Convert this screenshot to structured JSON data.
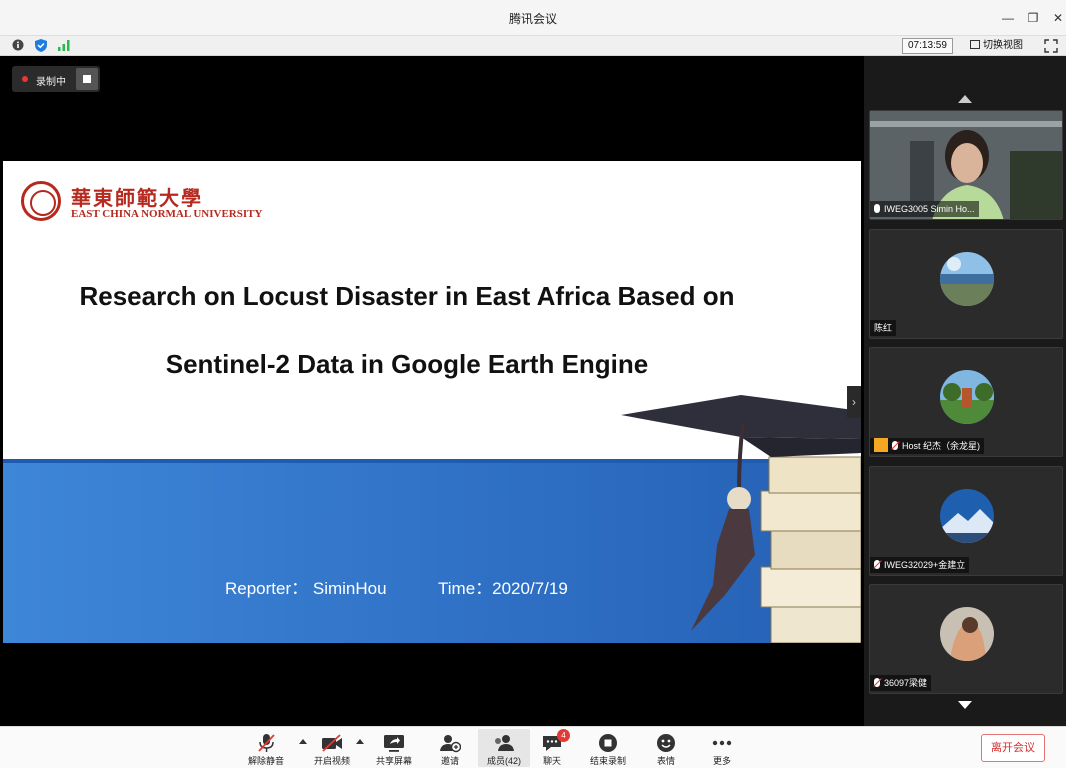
{
  "window": {
    "title": "腾讯会议"
  },
  "infobar": {
    "timer": "07:13:59",
    "switch_view": "切换视图"
  },
  "recording": {
    "label": "录制中"
  },
  "slide": {
    "logo_cn": "華東師範大學",
    "logo_en": "EAST CHINA NORMAL UNIVERSITY",
    "title_line1": "Research on Locust Disaster in East Africa Based on",
    "title_line2": "Sentinel-2 Data in Google Earth Engine",
    "reporter": "Reporter： SiminHou",
    "time": "Time：2020/7/19"
  },
  "participants": [
    {
      "name": "IWEG3005 Simin Ho...",
      "mic": "on"
    },
    {
      "name": "陈红",
      "mic": "none"
    },
    {
      "name": "Host 纪杰（余龙星)",
      "mic": "off",
      "host": true
    },
    {
      "name": "IWEG32029+金建立",
      "mic": "off"
    },
    {
      "name": "36097梁健",
      "mic": "off"
    }
  ],
  "toolbar": {
    "unmute": "解除静音",
    "start_video": "开启视频",
    "share_screen": "共享屏幕",
    "invite": "邀请",
    "members": "成员(42)",
    "chat": "聊天",
    "chat_badge": "4",
    "end_recording": "结束录制",
    "reactions": "表情",
    "more": "更多",
    "leave": "离开会议"
  },
  "colors": {
    "accent_red": "#e53935",
    "slide_blue": "#2e6fc4",
    "ecnu_red": "#b5291f"
  }
}
